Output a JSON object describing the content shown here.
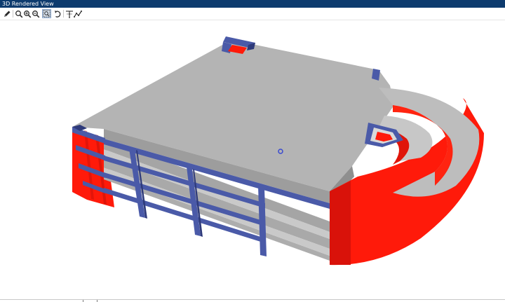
{
  "window": {
    "title": "3D Rendered View"
  },
  "toolbar": {
    "buttons": [
      {
        "name": "pencil-icon",
        "tooltip": ""
      },
      {
        "name": "zoom-icon",
        "tooltip": ""
      },
      {
        "name": "zoom-in-icon",
        "tooltip": ""
      },
      {
        "name": "zoom-out-icon",
        "tooltip": ""
      },
      {
        "name": "zoom-extents-icon",
        "tooltip": ""
      },
      {
        "name": "rotate-icon",
        "tooltip": ""
      },
      {
        "name": "pan-icon",
        "tooltip": ""
      },
      {
        "name": "draw-path-icon",
        "tooltip": ""
      }
    ]
  },
  "viewport": {
    "content": "3D building model",
    "colors": {
      "slab": "#b4b4b4",
      "slab_edge": "#9a9a9a",
      "wall": "#ff1a0a",
      "wall_dark": "#d60f06",
      "beam": "#4a5aa8",
      "beam_dark": "#2e3a7a"
    }
  }
}
